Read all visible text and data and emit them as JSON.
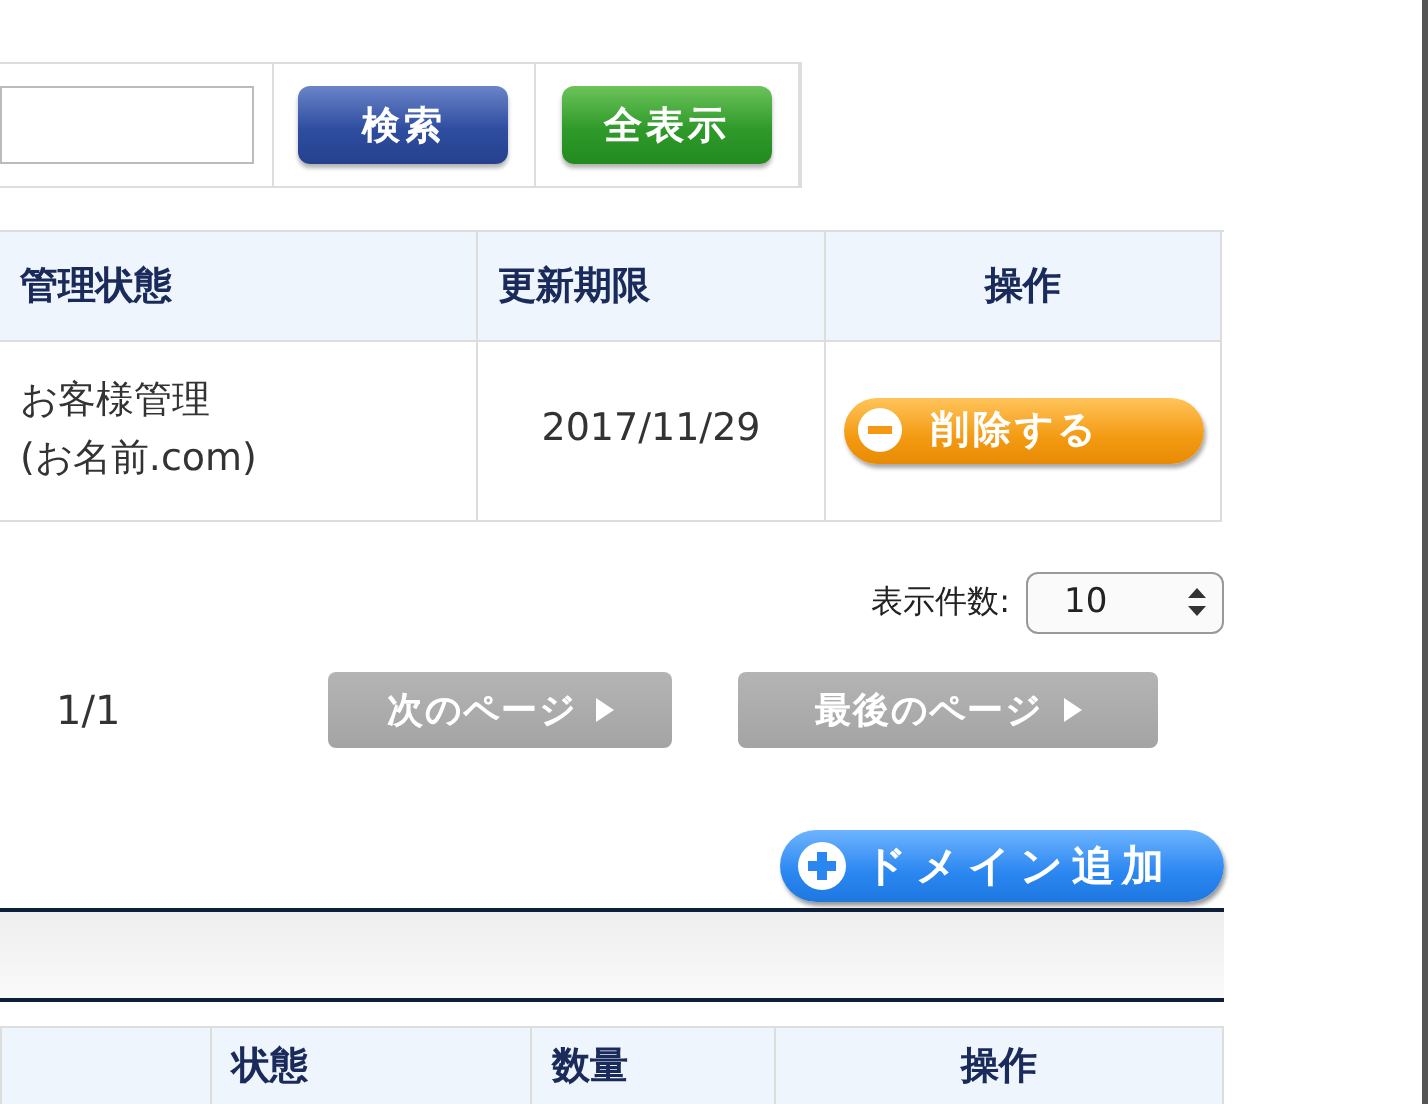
{
  "search": {
    "buttons": [
      {
        "label": "検索",
        "kind": "search"
      },
      {
        "label": "全表示",
        "kind": "all"
      }
    ]
  },
  "domain_table": {
    "columns": [
      "管理状態",
      "更新期限",
      "操作"
    ],
    "rows": [
      {
        "status": "お客様管理\n(お名前.com)",
        "expires": "2017/11/29",
        "action": "削除する"
      }
    ]
  },
  "per_page": {
    "label": "表示件数:",
    "value": "10"
  },
  "pagination": {
    "page": "1/1",
    "buttons": [
      {
        "label": "次のページ",
        "disabled": true
      },
      {
        "label": "最後のページ",
        "disabled": true
      }
    ]
  },
  "add_button": "ドメイン追加",
  "second_table": {
    "columns": [
      "状態",
      "数量",
      "操作"
    ]
  }
}
